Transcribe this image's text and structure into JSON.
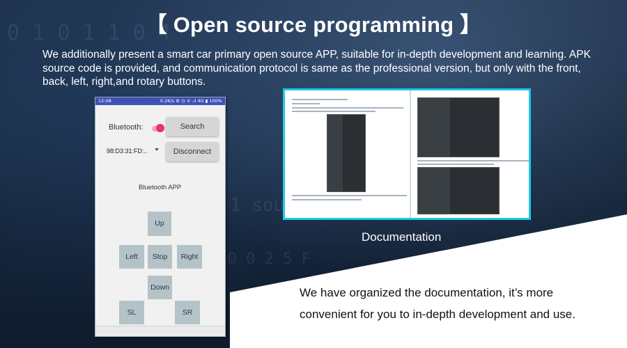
{
  "title": "【 Open source programming 】",
  "intro": "We additionally present a smart car primary open source APP, suitable for in-depth development and learning. APK source code is provided, and communication protocol is same as the professional version, but only with the front, back, left, right,and rotary buttons.",
  "phone": {
    "status_time": "12:08",
    "status_right": "0.2K/s ⚙ ◷ ᯤ .ıl 4G ▮ 100%",
    "bluetooth_label": "Bluetooth:",
    "toggle_on": true,
    "search_button": "Search",
    "device_address": "98:D3:31:FD:..",
    "disconnect_button": "Disconnect",
    "app_title": "Bluetooth APP",
    "controls": {
      "up": "Up",
      "left": "Left",
      "stop": "Stop",
      "right": "Right",
      "down": "Down",
      "sl": "SL",
      "sr": "SR"
    }
  },
  "documentation_caption": "Documentation",
  "description": "We have organized the documentation, it’s more convenient for you to in-depth development and use.",
  "colors": {
    "accent_border": "#1ec9e8",
    "status_bar": "#3f51b5",
    "toggle": "#e8336f",
    "dpad": "#b4c3c7"
  },
  "icons": [
    "dropdown-caret-icon"
  ]
}
